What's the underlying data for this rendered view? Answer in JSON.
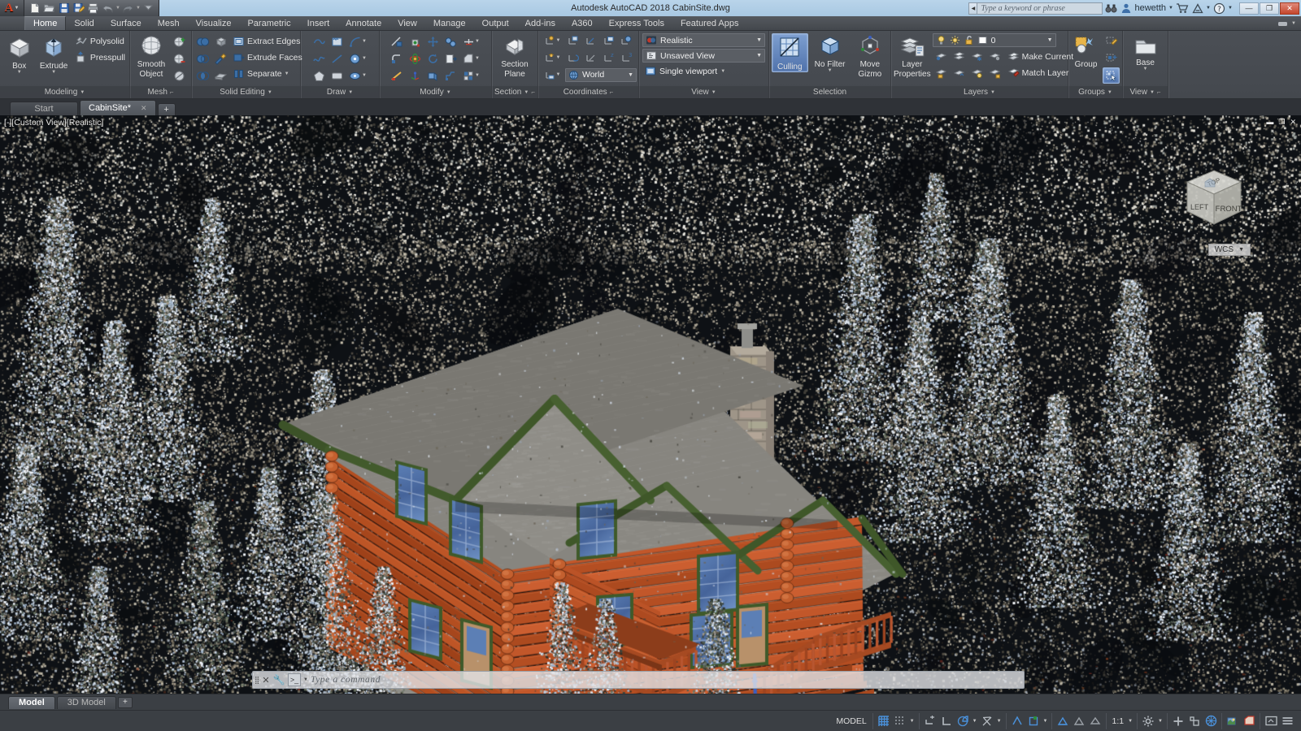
{
  "window": {
    "title": "Autodesk AutoCAD 2018    CabinSite.dwg",
    "app_logo": "A",
    "minimize": "—",
    "maximize": "❐",
    "close": "✕"
  },
  "quick_access": {
    "items": [
      {
        "name": "new-file-icon",
        "label": "New"
      },
      {
        "name": "open-file-icon",
        "label": "Open"
      },
      {
        "name": "save-icon",
        "label": "Save"
      },
      {
        "name": "save-as-icon",
        "label": "Save As"
      },
      {
        "name": "plot-icon",
        "label": "Plot"
      },
      {
        "name": "undo-icon",
        "label": "Undo"
      },
      {
        "name": "redo-icon",
        "label": "Redo"
      },
      {
        "name": "qat-dropdown-icon",
        "label": "Customize Quick Access Toolbar"
      }
    ]
  },
  "search": {
    "placeholder": "Type a keyword or phrase",
    "binoculars_icon": "search-binoculars-icon"
  },
  "account": {
    "user": "hewetth",
    "avatar_icon": "user-avatar-icon",
    "cart_icon": "shopping-cart-icon",
    "autodesk_icon": "autodesk-a-icon",
    "help_icon": "help-question-icon"
  },
  "ribbon": {
    "tabs": [
      {
        "label": "Home",
        "active": true
      },
      {
        "label": "Solid",
        "active": false
      },
      {
        "label": "Surface",
        "active": false
      },
      {
        "label": "Mesh",
        "active": false
      },
      {
        "label": "Visualize",
        "active": false
      },
      {
        "label": "Parametric",
        "active": false
      },
      {
        "label": "Insert",
        "active": false
      },
      {
        "label": "Annotate",
        "active": false
      },
      {
        "label": "View",
        "active": false
      },
      {
        "label": "Manage",
        "active": false
      },
      {
        "label": "Output",
        "active": false
      },
      {
        "label": "Add-ins",
        "active": false
      },
      {
        "label": "A360",
        "active": false
      },
      {
        "label": "Express Tools",
        "active": false
      },
      {
        "label": "Featured Apps",
        "active": false
      }
    ],
    "panels": {
      "modeling": {
        "title": "Modeling",
        "box": "Box",
        "extrude": "Extrude",
        "polysolid": "Polysolid",
        "presspull": "Presspull"
      },
      "mesh": {
        "title": "Mesh",
        "smooth_object_line1": "Smooth",
        "smooth_object_line2": "Object",
        "tools": [
          "smooth-more-icon",
          "smooth-less-icon",
          "refine-mesh-icon"
        ]
      },
      "solid_editing": {
        "title": "Solid Editing",
        "extract_edges": "Extract Edges",
        "extrude_faces": "Extrude Faces",
        "separate": "Separate",
        "tools": [
          "union-icon",
          "subtract-icon",
          "intersect-icon",
          "solid-history-icon",
          "imprint-icon",
          "shell-icon"
        ]
      },
      "draw": {
        "title": "Draw",
        "tools": [
          "polyline-icon",
          "revision-cloud-icon",
          "arc-icon",
          "spline-icon",
          "line-icon",
          "circle-icon",
          "polygon-icon",
          "rectangle-icon",
          "ellipse-icon"
        ]
      },
      "modify": {
        "title": "Modify",
        "tools": [
          "trim-icon",
          "3d-align-icon",
          "3d-move-icon",
          "3d-mirror-icon",
          "offset-icon",
          "fillet-edge-icon",
          "3d-rotate-icon",
          "rotate-icon",
          "extrude-face-icon",
          "chamfer-edge-icon",
          "slice-icon",
          "3d-scale-icon",
          "thicken-icon",
          "interfere-icon",
          "array-icon"
        ]
      },
      "section": {
        "title": "Section",
        "section_plane_line1": "Section",
        "section_plane_line2": "Plane"
      },
      "coordinates": {
        "title": "Coordinates",
        "ucs_world": "World",
        "tools": [
          "ucs-named-icon",
          "ucs-origin-icon",
          "ucs-3point-icon",
          "ucs-face-icon",
          "ucs-object-icon",
          "ucs-view-icon",
          "ucs-previous-icon",
          "ucs-x-icon",
          "ucs-y-icon",
          "ucs-z-icon",
          "ucs-display-icon"
        ]
      },
      "view": {
        "title": "View",
        "visual_style": "Realistic",
        "named_view": "Unsaved View",
        "viewport_config": "Single viewport"
      },
      "selection": {
        "title": "Selection",
        "culling": "Culling",
        "culling_active": true,
        "no_filter": "No Filter",
        "move_gizmo_line1": "Move",
        "move_gizmo_line2": "Gizmo"
      },
      "layers": {
        "title": "Layers",
        "layer_properties_line1": "Layer",
        "layer_properties_line2": "Properties",
        "current_layer": "0",
        "make_current": "Make Current",
        "match_layer": "Match Layer",
        "state_icons": [
          "layer-on-bulb-icon",
          "layer-freeze-sun-icon",
          "layer-lock-open-icon",
          "layer-color-swatch-icon"
        ]
      },
      "groups": {
        "title": "Groups",
        "group": "Group",
        "tools": [
          "ungroup-icon",
          "group-edit-icon",
          "group-selection-on-icon"
        ]
      },
      "view_panel": {
        "title": "View",
        "base": "Base"
      }
    }
  },
  "document_tabs": [
    {
      "label": "Start",
      "active": false,
      "closable": false
    },
    {
      "label": "CabinSite*",
      "active": true,
      "closable": true
    }
  ],
  "document_tab_add": "+",
  "viewport": {
    "label": "[-][Custom View][Realistic]",
    "controls": [
      "minimize-viewport-icon",
      "maximize-viewport-icon",
      "close-viewport-icon"
    ],
    "viewcube": {
      "top": "TOP",
      "left": "LEFT",
      "front": "FRONT"
    },
    "wcs": "WCS",
    "wcs_caret": "▼"
  },
  "command_line": {
    "placeholder": "Type a command",
    "prompt_glyph": "⌫",
    "close_glyph": "✕",
    "wrench_glyph": "wrench-icon"
  },
  "layout_tabs": [
    {
      "label": "Model",
      "active": true
    },
    {
      "label": "3D Model",
      "active": false
    }
  ],
  "layout_tab_add": "+",
  "status_bar": {
    "model_label": "MODEL",
    "scale": "1:1",
    "left_tools": [
      "command-grip-icon"
    ],
    "toggles": [
      {
        "name": "grid-display-icon",
        "active": true
      },
      {
        "name": "snap-mode-icon",
        "active": false
      },
      {
        "name": "infer-constraints-icon",
        "active": false
      },
      {
        "name": "ortho-mode-icon",
        "active": false
      },
      {
        "name": "polar-tracking-icon",
        "active": false
      },
      {
        "name": "object-snap-icon",
        "active": false
      },
      {
        "name": "3d-object-snap-icon",
        "active": false
      },
      {
        "name": "object-snap-tracking-icon",
        "active": false
      },
      {
        "name": "dynamic-ucs-icon",
        "active": false
      },
      {
        "name": "selection-cycling-icon",
        "active": true
      },
      {
        "name": "show-hide-lineweight-icon",
        "active": false
      },
      {
        "name": "transparency-icon",
        "active": false
      },
      {
        "name": "annotation-scale-icon",
        "active": false
      },
      {
        "name": "workspace-gear-icon",
        "active": false
      },
      {
        "name": "hardware-acceleration-icon",
        "active": false
      },
      {
        "name": "isolate-objects-icon",
        "active": false
      },
      {
        "name": "clean-screen-icon",
        "active": false
      },
      {
        "name": "customization-menu-icon",
        "active": false
      }
    ]
  },
  "colors": {
    "accent_blue": "#4f72ab",
    "ribbon_bg": "#484c52",
    "titlebar": "#b0cde6",
    "canvas_dark": "#14171b",
    "roof_gray": "#7d7b77",
    "log_orange": "#b04a22",
    "trim_green": "#3e5528",
    "chimney_tan": "#a9a096",
    "window_blue": "#4a6fa8",
    "door_tan": "#b8916a",
    "axis_x": "#c0392b",
    "axis_y": "#2e8b3a",
    "axis_z": "#3b5fc0"
  }
}
